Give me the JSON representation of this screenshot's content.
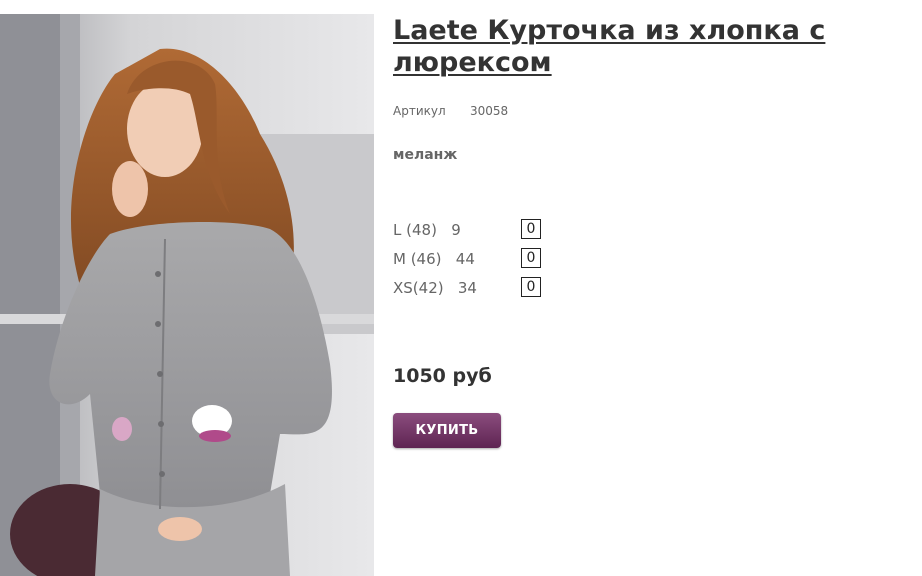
{
  "product": {
    "title": "Laete Курточка из хлопка с люрексом",
    "sku_label": "Артикул",
    "sku_value": "30058",
    "color": "меланж",
    "photo_subject": "model-in-grey-cardigan",
    "sizes": [
      {
        "label": "L (48)   9",
        "quantity": "0"
      },
      {
        "label": "M (46)   44",
        "quantity": "0"
      },
      {
        "label": "XS(42)   34",
        "quantity": "0"
      }
    ],
    "price": "1050 руб",
    "buy_label": "КУПИТЬ",
    "colors": {
      "accent": "#6e3363",
      "title": "#333333",
      "muted": "#666666"
    }
  }
}
